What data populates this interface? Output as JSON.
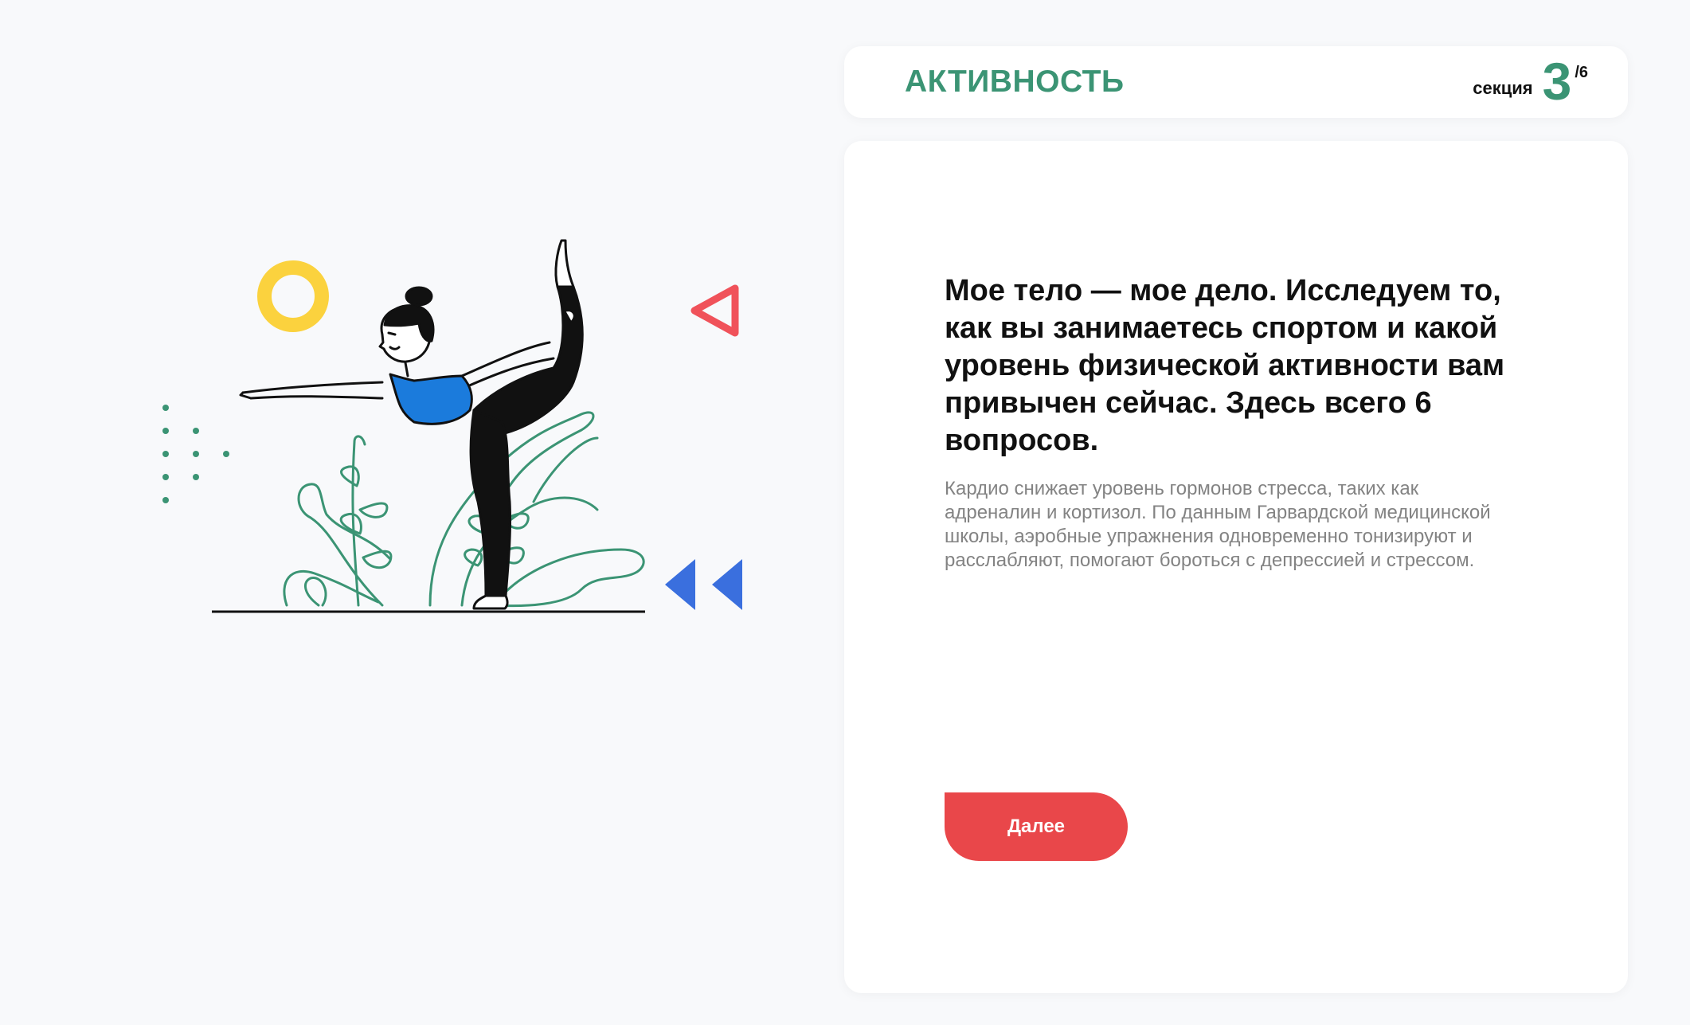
{
  "header": {
    "title": "АКТИВНОСТЬ",
    "section_label": "секция",
    "section_current": "3",
    "section_total": "/6"
  },
  "content": {
    "headline": "Мое тело — мое дело. Исследуем то, как вы занимаетесь спортом и какой уровень физической активности вам привычен сейчас. Здесь всего 6 вопросов.",
    "description": "Кардио снижает уровень гормонов стресса, таких как адреналин и кортизол. По данным Гарвардской медицинской школы, аэробные упражнения одновременно тонизируют и расслабляют, помогают бороться с депрессией и стрессом.",
    "next_button": "Далее"
  },
  "colors": {
    "accent_green": "#3b9474",
    "button_red": "#e9474a",
    "illustration_yellow": "#fbd23e",
    "illustration_red": "#f0525a",
    "illustration_blue": "#3a6fde",
    "top_blue": "#1b7bdc"
  },
  "illustration": {
    "subject": "woman-yoga-dancer-pose-icon"
  }
}
